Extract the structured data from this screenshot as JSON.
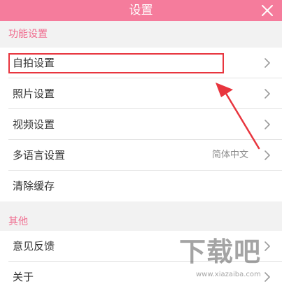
{
  "header": {
    "title": "设置",
    "close_icon": "close-icon",
    "background_color": "#f57c9c"
  },
  "sections": [
    {
      "label": "功能设置",
      "items": [
        {
          "label": "自拍设置",
          "value": "",
          "has_chevron": true,
          "highlighted": true
        },
        {
          "label": "照片设置",
          "value": "",
          "has_chevron": true
        },
        {
          "label": "视频设置",
          "value": "",
          "has_chevron": true
        },
        {
          "label": "多语言设置",
          "value": "简体中文",
          "has_chevron": true
        },
        {
          "label": "清除缓存",
          "value": "",
          "has_chevron": false
        }
      ]
    },
    {
      "label": "其他",
      "items": [
        {
          "label": "意见反馈",
          "value": "",
          "has_chevron": true
        },
        {
          "label": "关于",
          "value": "",
          "has_chevron": true
        }
      ]
    }
  ],
  "annotation": {
    "highlight_color": "#e8353e",
    "arrow_color": "#e8353e"
  },
  "watermark": {
    "text": "下载吧",
    "url": "www.xiazaiba.com"
  },
  "colors": {
    "accent": "#f06b8e",
    "row_background": "#ffffff",
    "page_background": "#f2f2f2"
  },
  "icons": {
    "chevron": "chevron-right-icon"
  }
}
